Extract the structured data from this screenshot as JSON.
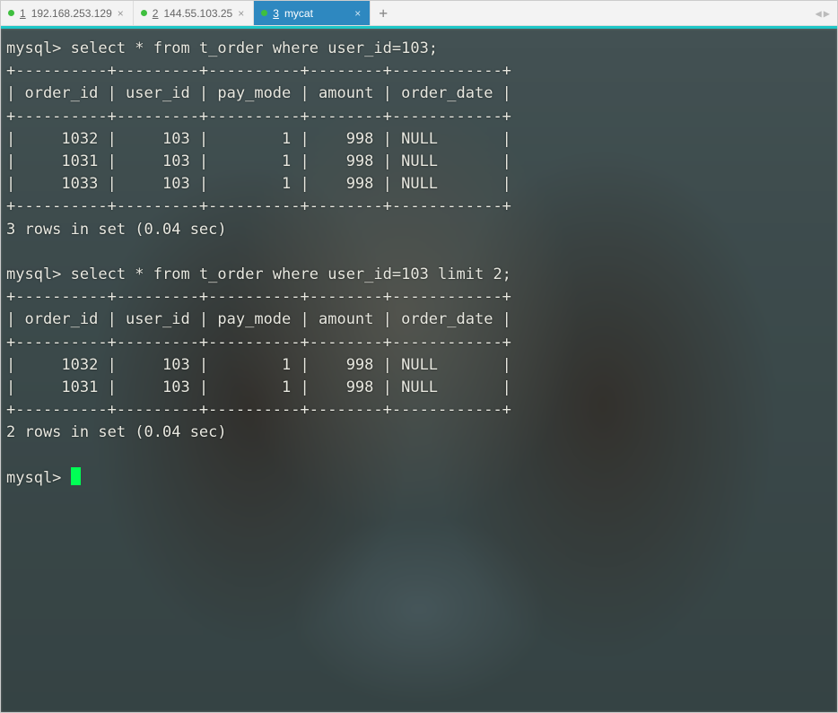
{
  "tabs": [
    {
      "num": "1",
      "label": "192.168.253.129",
      "active": false
    },
    {
      "num": "2",
      "label": "144.55.103.25",
      "active": false
    },
    {
      "num": "3",
      "label": "mycat",
      "active": true
    }
  ],
  "add_label": "+",
  "prompt": "mysql>",
  "queries": [
    {
      "sql": "select * from t_order where user_id=103;",
      "columns": [
        "order_id",
        "user_id",
        "pay_mode",
        "amount",
        "order_date"
      ],
      "rows": [
        {
          "order_id": "1032",
          "user_id": "103",
          "pay_mode": "1",
          "amount": "998",
          "order_date": "NULL"
        },
        {
          "order_id": "1031",
          "user_id": "103",
          "pay_mode": "1",
          "amount": "998",
          "order_date": "NULL"
        },
        {
          "order_id": "1033",
          "user_id": "103",
          "pay_mode": "1",
          "amount": "998",
          "order_date": "NULL"
        }
      ],
      "footer": "3 rows in set (0.04 sec)"
    },
    {
      "sql": "select * from t_order where user_id=103 limit 2;",
      "columns": [
        "order_id",
        "user_id",
        "pay_mode",
        "amount",
        "order_date"
      ],
      "rows": [
        {
          "order_id": "1032",
          "user_id": "103",
          "pay_mode": "1",
          "amount": "998",
          "order_date": "NULL"
        },
        {
          "order_id": "1031",
          "user_id": "103",
          "pay_mode": "1",
          "amount": "998",
          "order_date": "NULL"
        }
      ],
      "footer": "2 rows in set (0.04 sec)"
    }
  ],
  "col_widths": {
    "order_id": 10,
    "user_id": 9,
    "pay_mode": 10,
    "amount": 8,
    "order_date": 12
  }
}
